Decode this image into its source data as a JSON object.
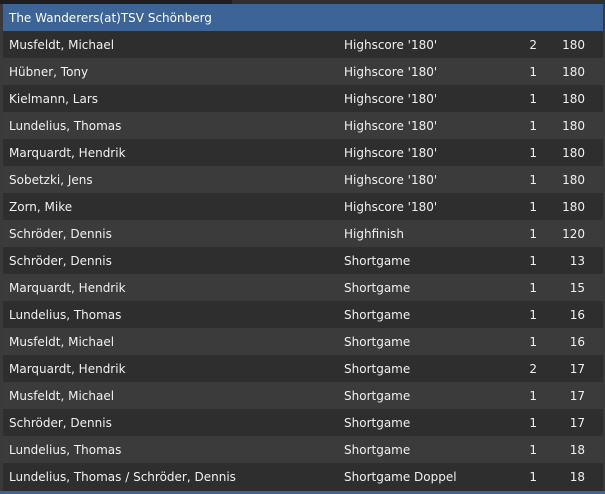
{
  "table": {
    "title": "The Wanderers(at)TSV Schönberg",
    "rows": [
      {
        "name": "Musfeldt, Michael",
        "category": "Highscore '180'",
        "count": "2",
        "score": "180"
      },
      {
        "name": "Hübner, Tony",
        "category": "Highscore '180'",
        "count": "1",
        "score": "180"
      },
      {
        "name": "Kielmann, Lars",
        "category": "Highscore '180'",
        "count": "1",
        "score": "180"
      },
      {
        "name": "Lundelius, Thomas",
        "category": "Highscore '180'",
        "count": "1",
        "score": "180"
      },
      {
        "name": "Marquardt, Hendrik",
        "category": "Highscore '180'",
        "count": "1",
        "score": "180"
      },
      {
        "name": "Sobetzki, Jens",
        "category": "Highscore '180'",
        "count": "1",
        "score": "180"
      },
      {
        "name": "Zorn, Mike",
        "category": "Highscore '180'",
        "count": "1",
        "score": "180"
      },
      {
        "name": "Schröder, Dennis",
        "category": "Highfinish",
        "count": "1",
        "score": "120"
      },
      {
        "name": "Schröder, Dennis",
        "category": "Shortgame",
        "count": "1",
        "score": "13"
      },
      {
        "name": "Marquardt, Hendrik",
        "category": "Shortgame",
        "count": "1",
        "score": "15"
      },
      {
        "name": "Lundelius, Thomas",
        "category": "Shortgame",
        "count": "1",
        "score": "16"
      },
      {
        "name": "Musfeldt, Michael",
        "category": "Shortgame",
        "count": "1",
        "score": "16"
      },
      {
        "name": "Marquardt, Hendrik",
        "category": "Shortgame",
        "count": "2",
        "score": "17"
      },
      {
        "name": "Musfeldt, Michael",
        "category": "Shortgame",
        "count": "1",
        "score": "17"
      },
      {
        "name": "Schröder, Dennis",
        "category": "Shortgame",
        "count": "1",
        "score": "17"
      },
      {
        "name": "Lundelius, Thomas",
        "category": "Shortgame",
        "count": "1",
        "score": "18"
      },
      {
        "name": "Lundelius, Thomas / Schröder, Dennis",
        "category": "Shortgame Doppel",
        "count": "1",
        "score": "18"
      }
    ]
  },
  "colors": {
    "header_bg": "#3c6496",
    "row_odd": "#2e2e2e",
    "row_even": "#3b3b3b",
    "text": "#f0f0f0"
  }
}
